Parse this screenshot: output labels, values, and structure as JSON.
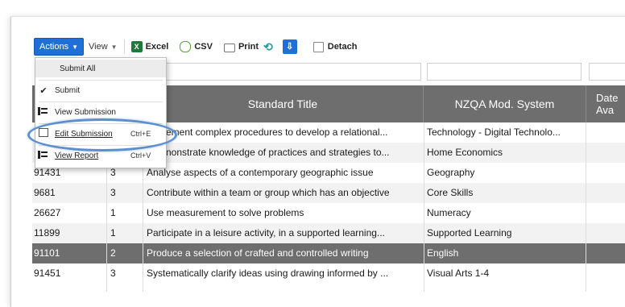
{
  "toolbar": {
    "actions": "Actions",
    "view": "View",
    "excel": "Excel",
    "excel_icon_text": "X",
    "csv": "CSV",
    "print": "Print",
    "detach": "Detach"
  },
  "menu": {
    "items": [
      {
        "label": "Submit All",
        "shortcut": ""
      },
      {
        "label": "Submit",
        "shortcut": ""
      },
      {
        "label": "View Submission",
        "shortcut": ""
      },
      {
        "label": "Edit Submission",
        "shortcut": "Ctrl+E"
      },
      {
        "label": "View Report",
        "shortcut": "Ctrl+V"
      }
    ]
  },
  "table": {
    "headers": [
      "Standard Title",
      "NZQA Mod. System",
      "Date Ava"
    ],
    "rows": [
      {
        "id": "",
        "level": "",
        "title": "ement complex procedures to develop a relational...",
        "system": "Technology - Digital Technolo..."
      },
      {
        "id": "",
        "level": "",
        "title": "nonstrate knowledge of practices and strategies to...",
        "system": "Home Economics"
      },
      {
        "id": "91431",
        "level": "3",
        "title": "Analyse aspects of a contemporary geographic issue",
        "system": "Geography"
      },
      {
        "id": "9681",
        "level": "3",
        "title": "Contribute within a team or group which has an objective",
        "system": "Core Skills"
      },
      {
        "id": "26627",
        "level": "1",
        "title": "Use measurement to solve problems",
        "system": "Numeracy"
      },
      {
        "id": "11899",
        "level": "1",
        "title": "Participate in a leisure activity, in a supported learning...",
        "system": "Supported Learning"
      },
      {
        "id": "91101",
        "level": "2",
        "title": "Produce a selection of crafted and controlled writing",
        "system": "English"
      },
      {
        "id": "91451",
        "level": "3",
        "title": "Systematically clarify ideas using drawing informed by ...",
        "system": "Visual Arts 1-4"
      }
    ]
  }
}
